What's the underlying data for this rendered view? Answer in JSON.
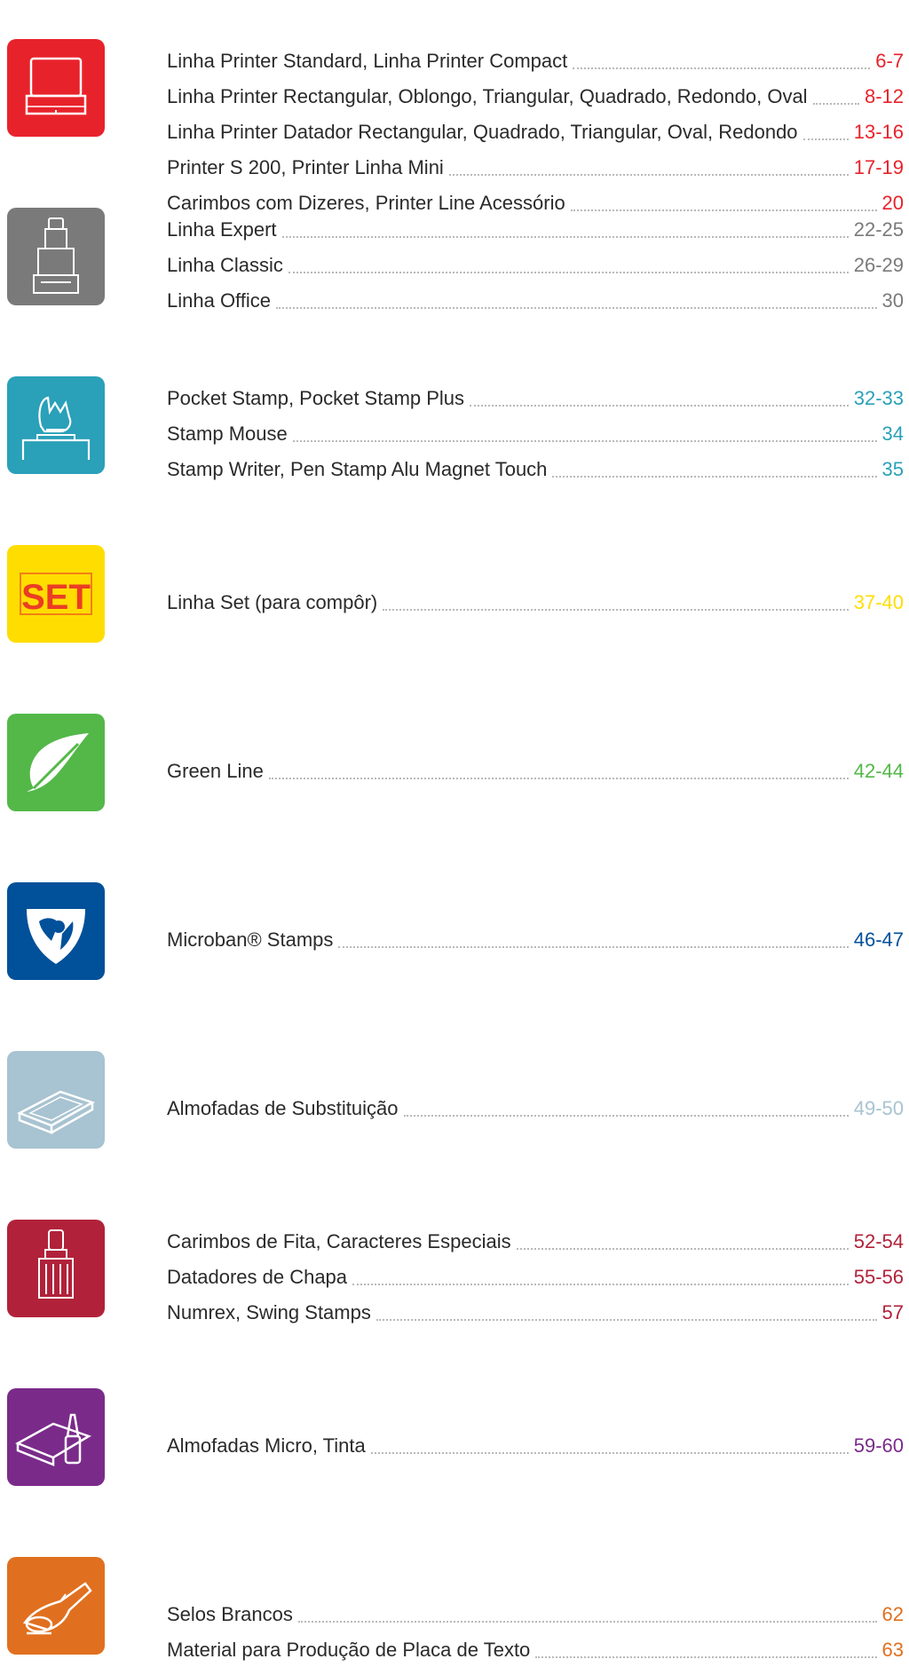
{
  "sections": [
    {
      "id": "printer",
      "color": "#e8222b",
      "icon": "self-inking-stamp-icon",
      "entries": [
        {
          "label": "Linha Printer Standard, Linha Printer Compact",
          "pages": "6-7"
        },
        {
          "label": "Linha Printer Rectangular, Oblongo, Triangular, Quadrado, Redondo, Oval",
          "pages": "8-12"
        },
        {
          "label": "Linha Printer Datador Rectangular, Quadrado, Triangular, Oval, Redondo",
          "pages": "13-16"
        },
        {
          "label": "Printer S 200, Printer Linha Mini",
          "pages": "17-19"
        },
        {
          "label": "Carimbos com Dizeres, Printer Line Acessório",
          "pages": "20"
        }
      ]
    },
    {
      "id": "expert",
      "color": "#7a7a7a",
      "icon": "expert-stamp-icon",
      "entries": [
        {
          "label": "Linha Expert",
          "pages": "22-25"
        },
        {
          "label": "Linha Classic",
          "pages": "26-29"
        },
        {
          "label": "Linha Office",
          "pages": "30"
        }
      ]
    },
    {
      "id": "pocket",
      "color": "#2aa0b9",
      "icon": "hand-stamp-icon",
      "entries": [
        {
          "label": "Pocket Stamp, Pocket Stamp Plus",
          "pages": "32-33"
        },
        {
          "label": "Stamp Mouse",
          "pages": "34"
        },
        {
          "label": "Stamp Writer, Pen Stamp Alu Magnet Touch",
          "pages": "35"
        }
      ]
    },
    {
      "id": "set",
      "color": "#ffdd00",
      "icon": "set-icon",
      "icon_text": "SET",
      "entries": [
        {
          "label": "Linha Set (para compôr)",
          "pages": "37-40"
        }
      ]
    },
    {
      "id": "green",
      "color": "#53b848",
      "icon": "leaf-icon",
      "entries": [
        {
          "label": "Green Line",
          "pages": "42-44"
        }
      ]
    },
    {
      "id": "microban",
      "color": "#00509a",
      "icon": "microban-shield-icon",
      "entries": [
        {
          "label": "Microban® Stamps",
          "pages": "46-47"
        }
      ]
    },
    {
      "id": "pads",
      "color": "#a8c3d1",
      "icon": "ink-pad-icon",
      "entries": [
        {
          "label": "Almofadas de Substituição",
          "pages": "49-50"
        }
      ]
    },
    {
      "id": "band",
      "color": "#b1223a",
      "icon": "band-stamp-icon",
      "entries": [
        {
          "label": "Carimbos de Fita, Caracteres Especiais",
          "pages": "52-54"
        },
        {
          "label": "Datadores de Chapa",
          "pages": "55-56"
        },
        {
          "label": "Numrex, Swing Stamps",
          "pages": "57"
        }
      ]
    },
    {
      "id": "micro",
      "color": "#7a2b8a",
      "icon": "stamp-pad-ink-icon",
      "entries": [
        {
          "label": "Almofadas Micro, Tinta",
          "pages": "59-60"
        }
      ]
    },
    {
      "id": "seal",
      "color": "#e0701f",
      "icon": "embosser-icon",
      "entries": [
        {
          "label": "Selos Brancos",
          "pages": "62"
        },
        {
          "label": "Material para Produção de Placa de Texto",
          "pages": "63"
        }
      ]
    }
  ]
}
